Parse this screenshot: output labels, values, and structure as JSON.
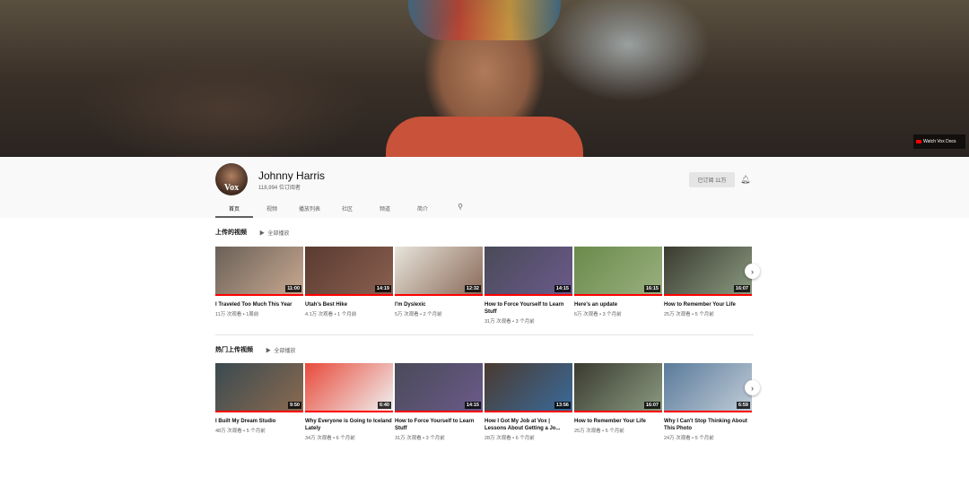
{
  "banner": {
    "link_label": "Watch Vox Docs"
  },
  "channel": {
    "name": "Johnny Harris",
    "subscribers": "118,994 位订阅者",
    "avatar_text": "Vox",
    "subscribe_label": "已订阅 11万"
  },
  "tabs": [
    "首页",
    "视频",
    "播放列表",
    "社区",
    "频道",
    "简介"
  ],
  "sections": [
    {
      "title": "上传的视频",
      "play_all": "全部播放",
      "videos": [
        {
          "title": "I Traveled Too Much This Year",
          "meta": "11万 次观看 • 1周前",
          "duration": "11:00",
          "colors": [
            "#6a6058",
            "#c8a890"
          ]
        },
        {
          "title": "Utah's Best Hike",
          "meta": "4.1万 次观看 • 1 个月前",
          "duration": "14:19",
          "colors": [
            "#5a3a30",
            "#8a6050"
          ]
        },
        {
          "title": "I'm Dyslexic",
          "meta": "5万 次观看 • 2 个月前",
          "duration": "12:32",
          "colors": [
            "#e8e4dc",
            "#8a6a58"
          ]
        },
        {
          "title": "How to Force Yourself to Learn Stuff",
          "meta": "31万 次观看 • 3 个月前",
          "duration": "14:15",
          "colors": [
            "#4a4a58",
            "#6a5a8a"
          ]
        },
        {
          "title": "Here's an update",
          "meta": "6万 次观看 • 3 个月前",
          "duration": "16:15",
          "colors": [
            "#6a8a4a",
            "#9ab080"
          ]
        },
        {
          "title": "How to Remember Your Life",
          "meta": "25万 次观看 • 5 个月前",
          "duration": "16:07",
          "colors": [
            "#3a3a30",
            "#8a9a80"
          ]
        }
      ]
    },
    {
      "title": "热门上传视频",
      "play_all": "全部播放",
      "videos": [
        {
          "title": "I Built My Dream Studio",
          "meta": "48万 次观看 • 5 个月前",
          "duration": "9:50",
          "colors": [
            "#3a4a50",
            "#8a6a50"
          ]
        },
        {
          "title": "Why Everyone is Going to Iceland Lately",
          "meta": "34万 次观看 • 6 个月前",
          "duration": "6:40",
          "colors": [
            "#e84a3a",
            "#f0f0f0"
          ]
        },
        {
          "title": "How to Force Yourself to Learn Stuff",
          "meta": "31万 次观看 • 3 个月前",
          "duration": "14:15",
          "colors": [
            "#4a4a58",
            "#6a5a8a"
          ]
        },
        {
          "title": "How I Got My Job at Vox | Lessons About Getting a Jo...",
          "meta": "28万 次观看 • 6 个月前",
          "duration": "13:56",
          "colors": [
            "#4a3a30",
            "#3a6a9a"
          ]
        },
        {
          "title": "How to Remember Your Life",
          "meta": "25万 次观看 • 5 个月前",
          "duration": "16:07",
          "colors": [
            "#3a3a30",
            "#8a9a80"
          ]
        },
        {
          "title": "Why I Can't Stop Thinking About This Photo",
          "meta": "24万 次观看 • 5 个月前",
          "duration": "6:59",
          "colors": [
            "#5a7a9a",
            "#c0ccd8"
          ]
        }
      ]
    }
  ]
}
